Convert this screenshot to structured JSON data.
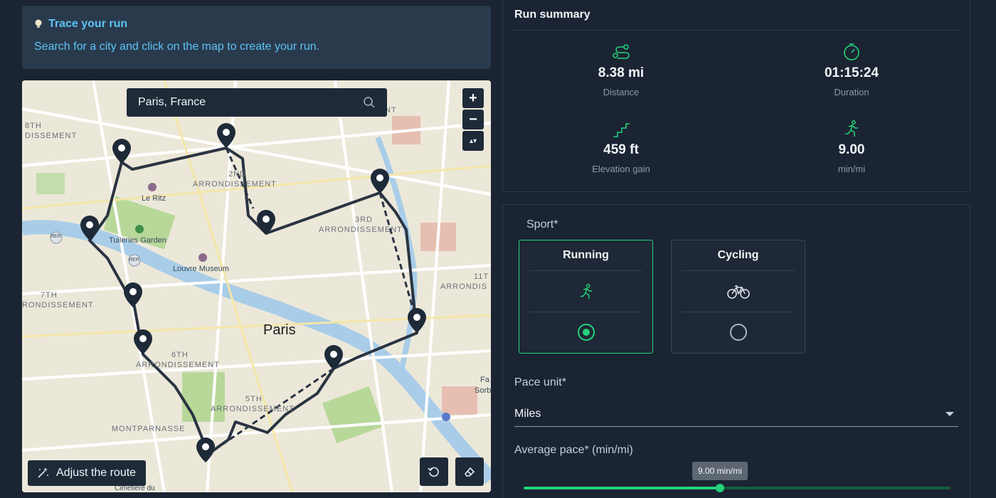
{
  "info": {
    "title": "Trace your run",
    "text": "Search for a city and click on the map to create your run."
  },
  "map": {
    "search_value": "Paris, France",
    "zoom_in": "+",
    "zoom_out": "−",
    "compass": "▴▾",
    "adjust_button": "Adjust the route",
    "labels": {
      "eighth": "8TH",
      "eighth_b": "DISSEMENT",
      "second": "2ND",
      "second_b": "ARRONDISSEMENT",
      "third": "3RD",
      "third_b": "ARRONDISSEMENT",
      "eleventh": "11T",
      "eleventh_b": "ARRONDIS",
      "seventh": "7TH",
      "seventh_b": "RONDISSEMENT",
      "sixth": "6TH",
      "sixth_b": "ARRONDISSEMENT",
      "fifth": "5TH",
      "fifth_b": "ARRONDISSEMENT",
      "montparnasse": "MONTPARNASSE",
      "le_ritz": "Le Ritz",
      "tuileries": "Tuileries Garden",
      "louvre": "Louvre Museum",
      "city": "Paris",
      "fa": "Fa",
      "sorb": "Sorb",
      "cimetiere": "Cimetière du",
      "nt": "NT",
      "rer1": "RER",
      "rer2": "RER"
    }
  },
  "summary": {
    "title": "Run summary",
    "distance_value": "8.38 mi",
    "distance_label": "Distance",
    "duration_value": "01:15:24",
    "duration_label": "Duration",
    "elevation_value": "459 ft",
    "elevation_label": "Elevation gain",
    "pace_value": "9.00",
    "pace_label": "min/mi"
  },
  "form": {
    "sport_label": "Sport*",
    "sports": [
      {
        "name": "Running",
        "icon": "runner-icon",
        "selected": true
      },
      {
        "name": "Cycling",
        "icon": "bicycle-icon",
        "selected": false
      }
    ],
    "pace_unit_label": "Pace unit*",
    "pace_unit_value": "Miles",
    "avg_pace_label": "Average pace* (min/mi)",
    "avg_pace_tooltip": "9.00 min/mi",
    "avg_pace_fraction": 0.46
  },
  "colors": {
    "accent": "#22d37a",
    "info_text": "#5cc4f5",
    "background": "#1b2433"
  }
}
